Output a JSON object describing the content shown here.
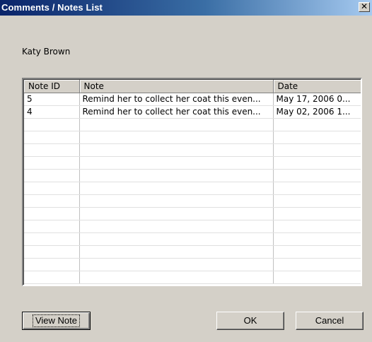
{
  "window": {
    "title": "Comments / Notes List",
    "close_glyph": "✕"
  },
  "customer_name": "Katy Brown",
  "grid": {
    "columns": [
      "Note ID",
      "Note",
      "Date"
    ],
    "rows": [
      [
        "5",
        "Remind her to collect her coat this even...",
        "May 17, 2006 0..."
      ],
      [
        "4",
        "Remind her to collect her coat this even...",
        "May 02, 2006 1..."
      ],
      [
        "",
        "",
        ""
      ],
      [
        "",
        "",
        ""
      ],
      [
        "",
        "",
        ""
      ],
      [
        "",
        "",
        ""
      ],
      [
        "",
        "",
        ""
      ],
      [
        "",
        "",
        ""
      ],
      [
        "",
        "",
        ""
      ],
      [
        "",
        "",
        ""
      ],
      [
        "",
        "",
        ""
      ],
      [
        "",
        "",
        ""
      ],
      [
        "",
        "",
        ""
      ],
      [
        "",
        "",
        ""
      ],
      [
        "",
        "",
        ""
      ]
    ]
  },
  "buttons": {
    "view_note": "View Note",
    "ok": "OK",
    "cancel": "Cancel"
  }
}
